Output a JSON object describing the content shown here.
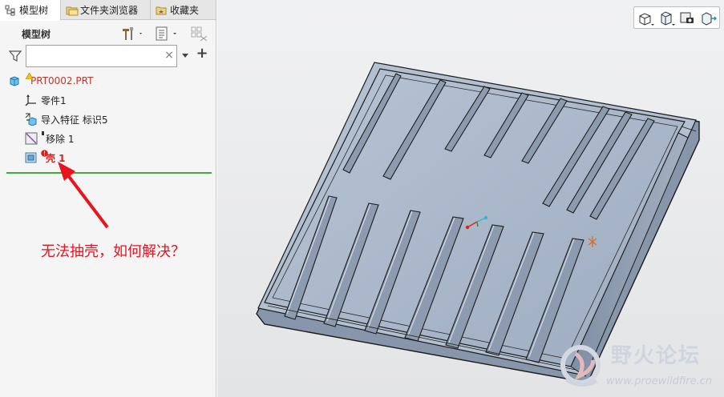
{
  "tabs": [
    {
      "label": "模型树",
      "icon": "model-tree-icon",
      "active": true
    },
    {
      "label": "文件夹浏览器",
      "icon": "folder-browser-icon",
      "active": false
    },
    {
      "label": "收藏夹",
      "icon": "favorites-icon",
      "active": false
    }
  ],
  "tree": {
    "title": "模型树",
    "toolbar_icons": [
      "settings-tools-icon",
      "show-options-icon",
      "tree-columns-icon"
    ],
    "search": {
      "value": "",
      "placeholder": ""
    },
    "nodes": [
      {
        "label": "PRT0002.PRT",
        "icon": "part-icon",
        "status": "warning"
      },
      {
        "label": "零件1",
        "icon": "csys-icon"
      },
      {
        "label": "导入特征 标识5",
        "icon": "import-feature-icon"
      },
      {
        "label": "移除 1",
        "icon": "remove-surface-icon"
      },
      {
        "label": "壳 1",
        "icon": "shell-icon",
        "status": "error"
      }
    ]
  },
  "annotation": "无法抽壳，如何解决？",
  "view_toolbar": [
    "view-orientation-icon",
    "saved-views-icon",
    "display-style-icon",
    "spin-center-icon"
  ],
  "watermark": {
    "title": "野火论坛",
    "url": "www.proewildfire.cn"
  },
  "colors": {
    "error": "#d2231e",
    "annotation": "#e8141e",
    "insert_line": "#3fae34",
    "model": "#a9b6c8"
  }
}
